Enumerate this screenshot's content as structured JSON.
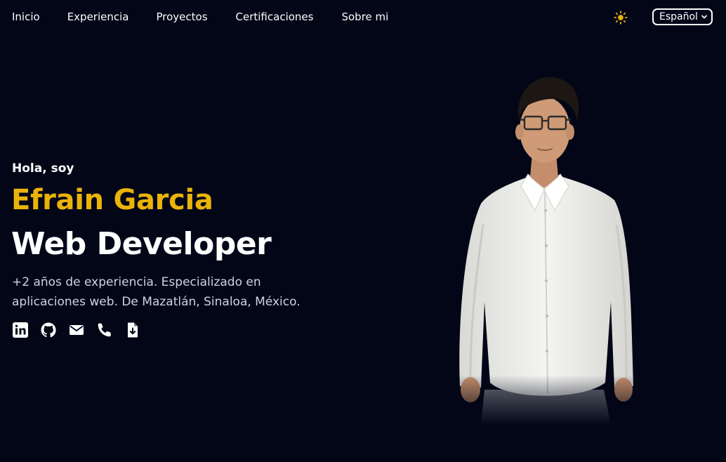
{
  "nav": {
    "links": [
      {
        "label": "Inicio"
      },
      {
        "label": "Experiencia"
      },
      {
        "label": "Proyectos"
      },
      {
        "label": "Certificaciones"
      },
      {
        "label": "Sobre mi"
      }
    ],
    "theme_icon": "sun-icon",
    "language": {
      "selected": "Español",
      "icon": "chevron-down-icon"
    }
  },
  "hero": {
    "greeting": "Hola, soy",
    "name": "Efrain Garcia",
    "role": "Web Developer",
    "description": "+2 años de experiencia. Especializado en aplicaciones web. De Mazatlán, Sinaloa, México."
  },
  "social": [
    {
      "icon": "linkedin-icon"
    },
    {
      "icon": "github-icon"
    },
    {
      "icon": "mail-icon"
    },
    {
      "icon": "phone-icon"
    },
    {
      "icon": "download-cv-icon"
    }
  ],
  "colors": {
    "background": "#020617",
    "accent": "#eab308",
    "text": "#ffffff",
    "muted_text": "#cbd5e1"
  }
}
